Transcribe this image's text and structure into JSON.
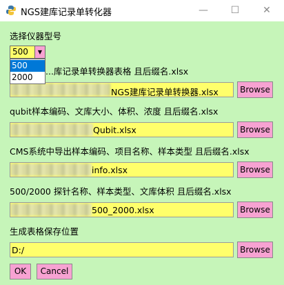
{
  "window": {
    "title": "NGS建库记录单转化器",
    "minimize": "—",
    "maximize": "☐",
    "close": "✕"
  },
  "instrument": {
    "label": "选择仪器型号",
    "selected": "500",
    "options": [
      "500",
      "2000"
    ]
  },
  "rows": [
    {
      "label": "...库记录单转换器表格 且后缀名.xlsx",
      "value": "NGS建库记录单转换器.xlsx",
      "button": "Browse"
    },
    {
      "label": "qubit样本编码、文库大小、体积、浓度 且后缀名.xlsx",
      "value": "Qubit.xlsx",
      "button": "Browse"
    },
    {
      "label": "CMS系统中导出样本编码、项目名称、样本类型 且后缀名.xlsx",
      "value": "info.xlsx",
      "button": "Browse"
    },
    {
      "label": "500/2000 探针名称、样本类型、文库体积 且后缀名.xlsx",
      "value": "500_2000.xlsx",
      "button": "Browse"
    },
    {
      "label": "生成表格保存位置",
      "value": "D:/",
      "button": "Browse"
    }
  ],
  "actions": {
    "ok": "OK",
    "cancel": "Cancel"
  }
}
